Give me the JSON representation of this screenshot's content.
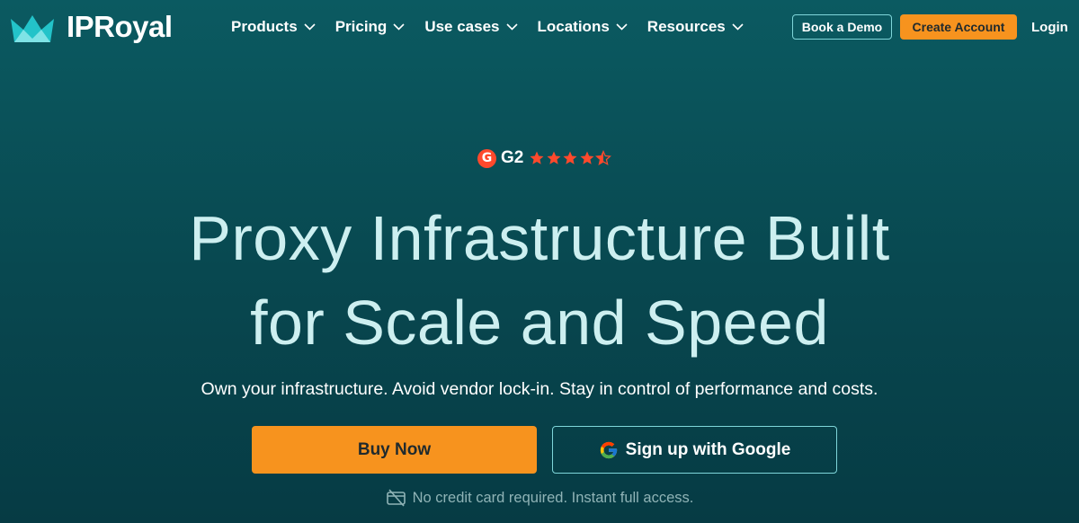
{
  "header": {
    "brand": "IPRoyal",
    "nav": [
      {
        "label": "Products"
      },
      {
        "label": "Pricing"
      },
      {
        "label": "Use cases"
      },
      {
        "label": "Locations"
      },
      {
        "label": "Resources"
      }
    ],
    "book_demo": "Book a Demo",
    "create_account": "Create Account",
    "login": "Login"
  },
  "rating": {
    "badge": "G",
    "label": "G2",
    "stars": 4.5,
    "star_color": "#ff492c"
  },
  "hero": {
    "headline_line1": "Proxy Infrastructure Built",
    "headline_line2": "for Scale and Speed",
    "subtitle": "Own your infrastructure. Avoid vendor lock-in. Stay in control of performance and costs.",
    "buy_now": "Buy Now",
    "google_signup": "Sign up with Google",
    "note": "No credit card required. Instant full access."
  },
  "colors": {
    "background": "#08474f",
    "accent": "#f7931e",
    "outline": "#7fd6da",
    "headline": "#cdeff0"
  },
  "icons": [
    "ipr-logo-icon",
    "chevron-down-icon",
    "g2-logo-icon",
    "star-icon",
    "google-icon",
    "no-credit-card-icon"
  ]
}
